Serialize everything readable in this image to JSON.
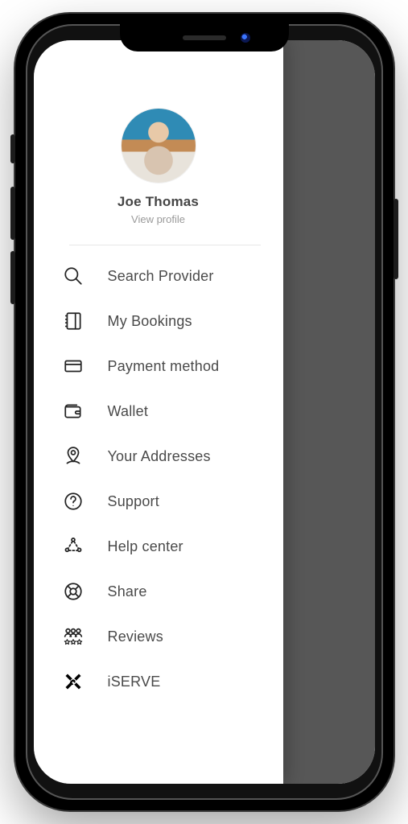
{
  "profile": {
    "name": "Joe Thomas",
    "view_label": "View profile"
  },
  "menu": {
    "items": [
      {
        "icon": "search-icon",
        "label": "Search Provider"
      },
      {
        "icon": "bookings-icon",
        "label": "My Bookings"
      },
      {
        "icon": "card-icon",
        "label": "Payment method"
      },
      {
        "icon": "wallet-icon",
        "label": "Wallet"
      },
      {
        "icon": "pin-icon",
        "label": "Your Addresses"
      },
      {
        "icon": "question-icon",
        "label": "Support"
      },
      {
        "icon": "nodes-icon",
        "label": "Help center"
      },
      {
        "icon": "lifebuoy-icon",
        "label": "Share"
      },
      {
        "icon": "people-icon",
        "label": "Reviews"
      },
      {
        "icon": "iserve-icon",
        "label": "iSERVE"
      }
    ]
  }
}
